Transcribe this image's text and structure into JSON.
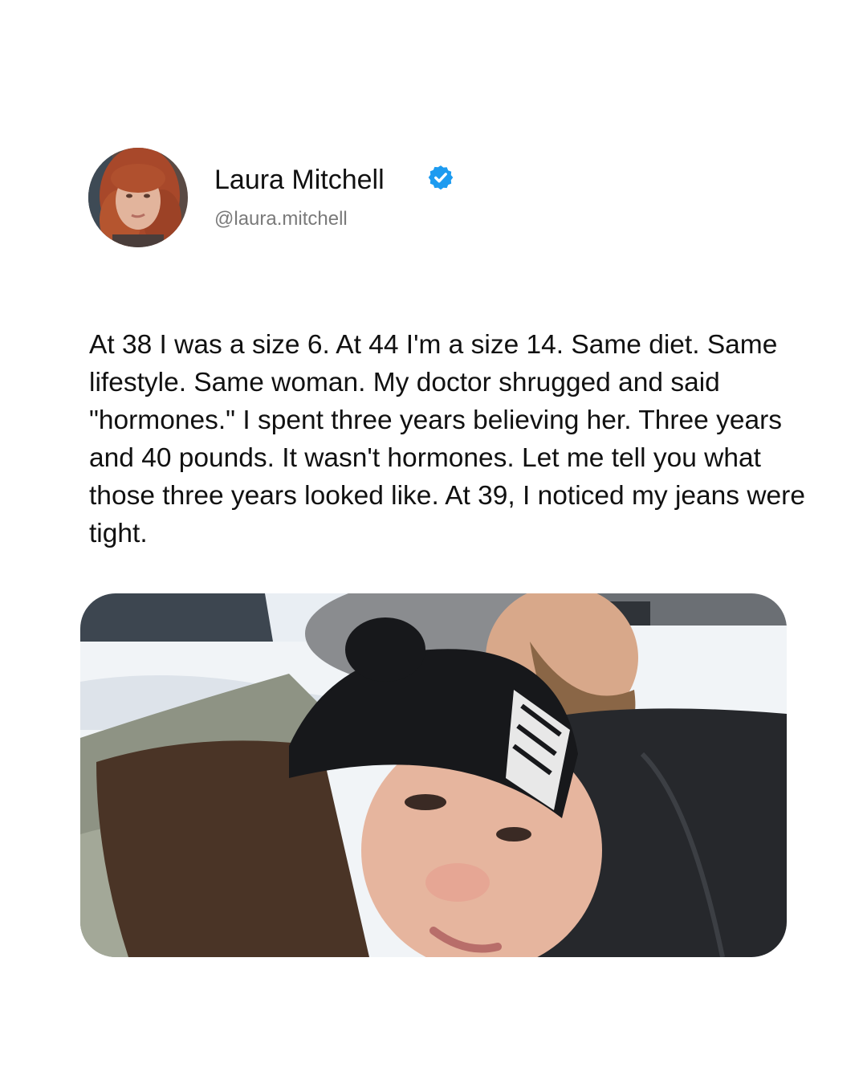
{
  "post": {
    "author": {
      "name": "Laura Mitchell",
      "handle": "@laura.mitchell",
      "verified": true,
      "verified_icon": "verified-badge-icon",
      "verified_color": "#1d9bf0"
    },
    "text": "At 38 I was a size 6. At 44 I'm a size 14. Same diet. Same lifestyle. Same woman. My doctor shrugged and said \"hormones.\" I spent three years believing her. Three years and 40 pounds. It wasn't hormones. Let me tell you what those three years looked like. At 39, I noticed my jeans were tight."
  },
  "colors": {
    "background": "#ffffff",
    "text": "#111111",
    "handle": "#7a7a7a"
  }
}
